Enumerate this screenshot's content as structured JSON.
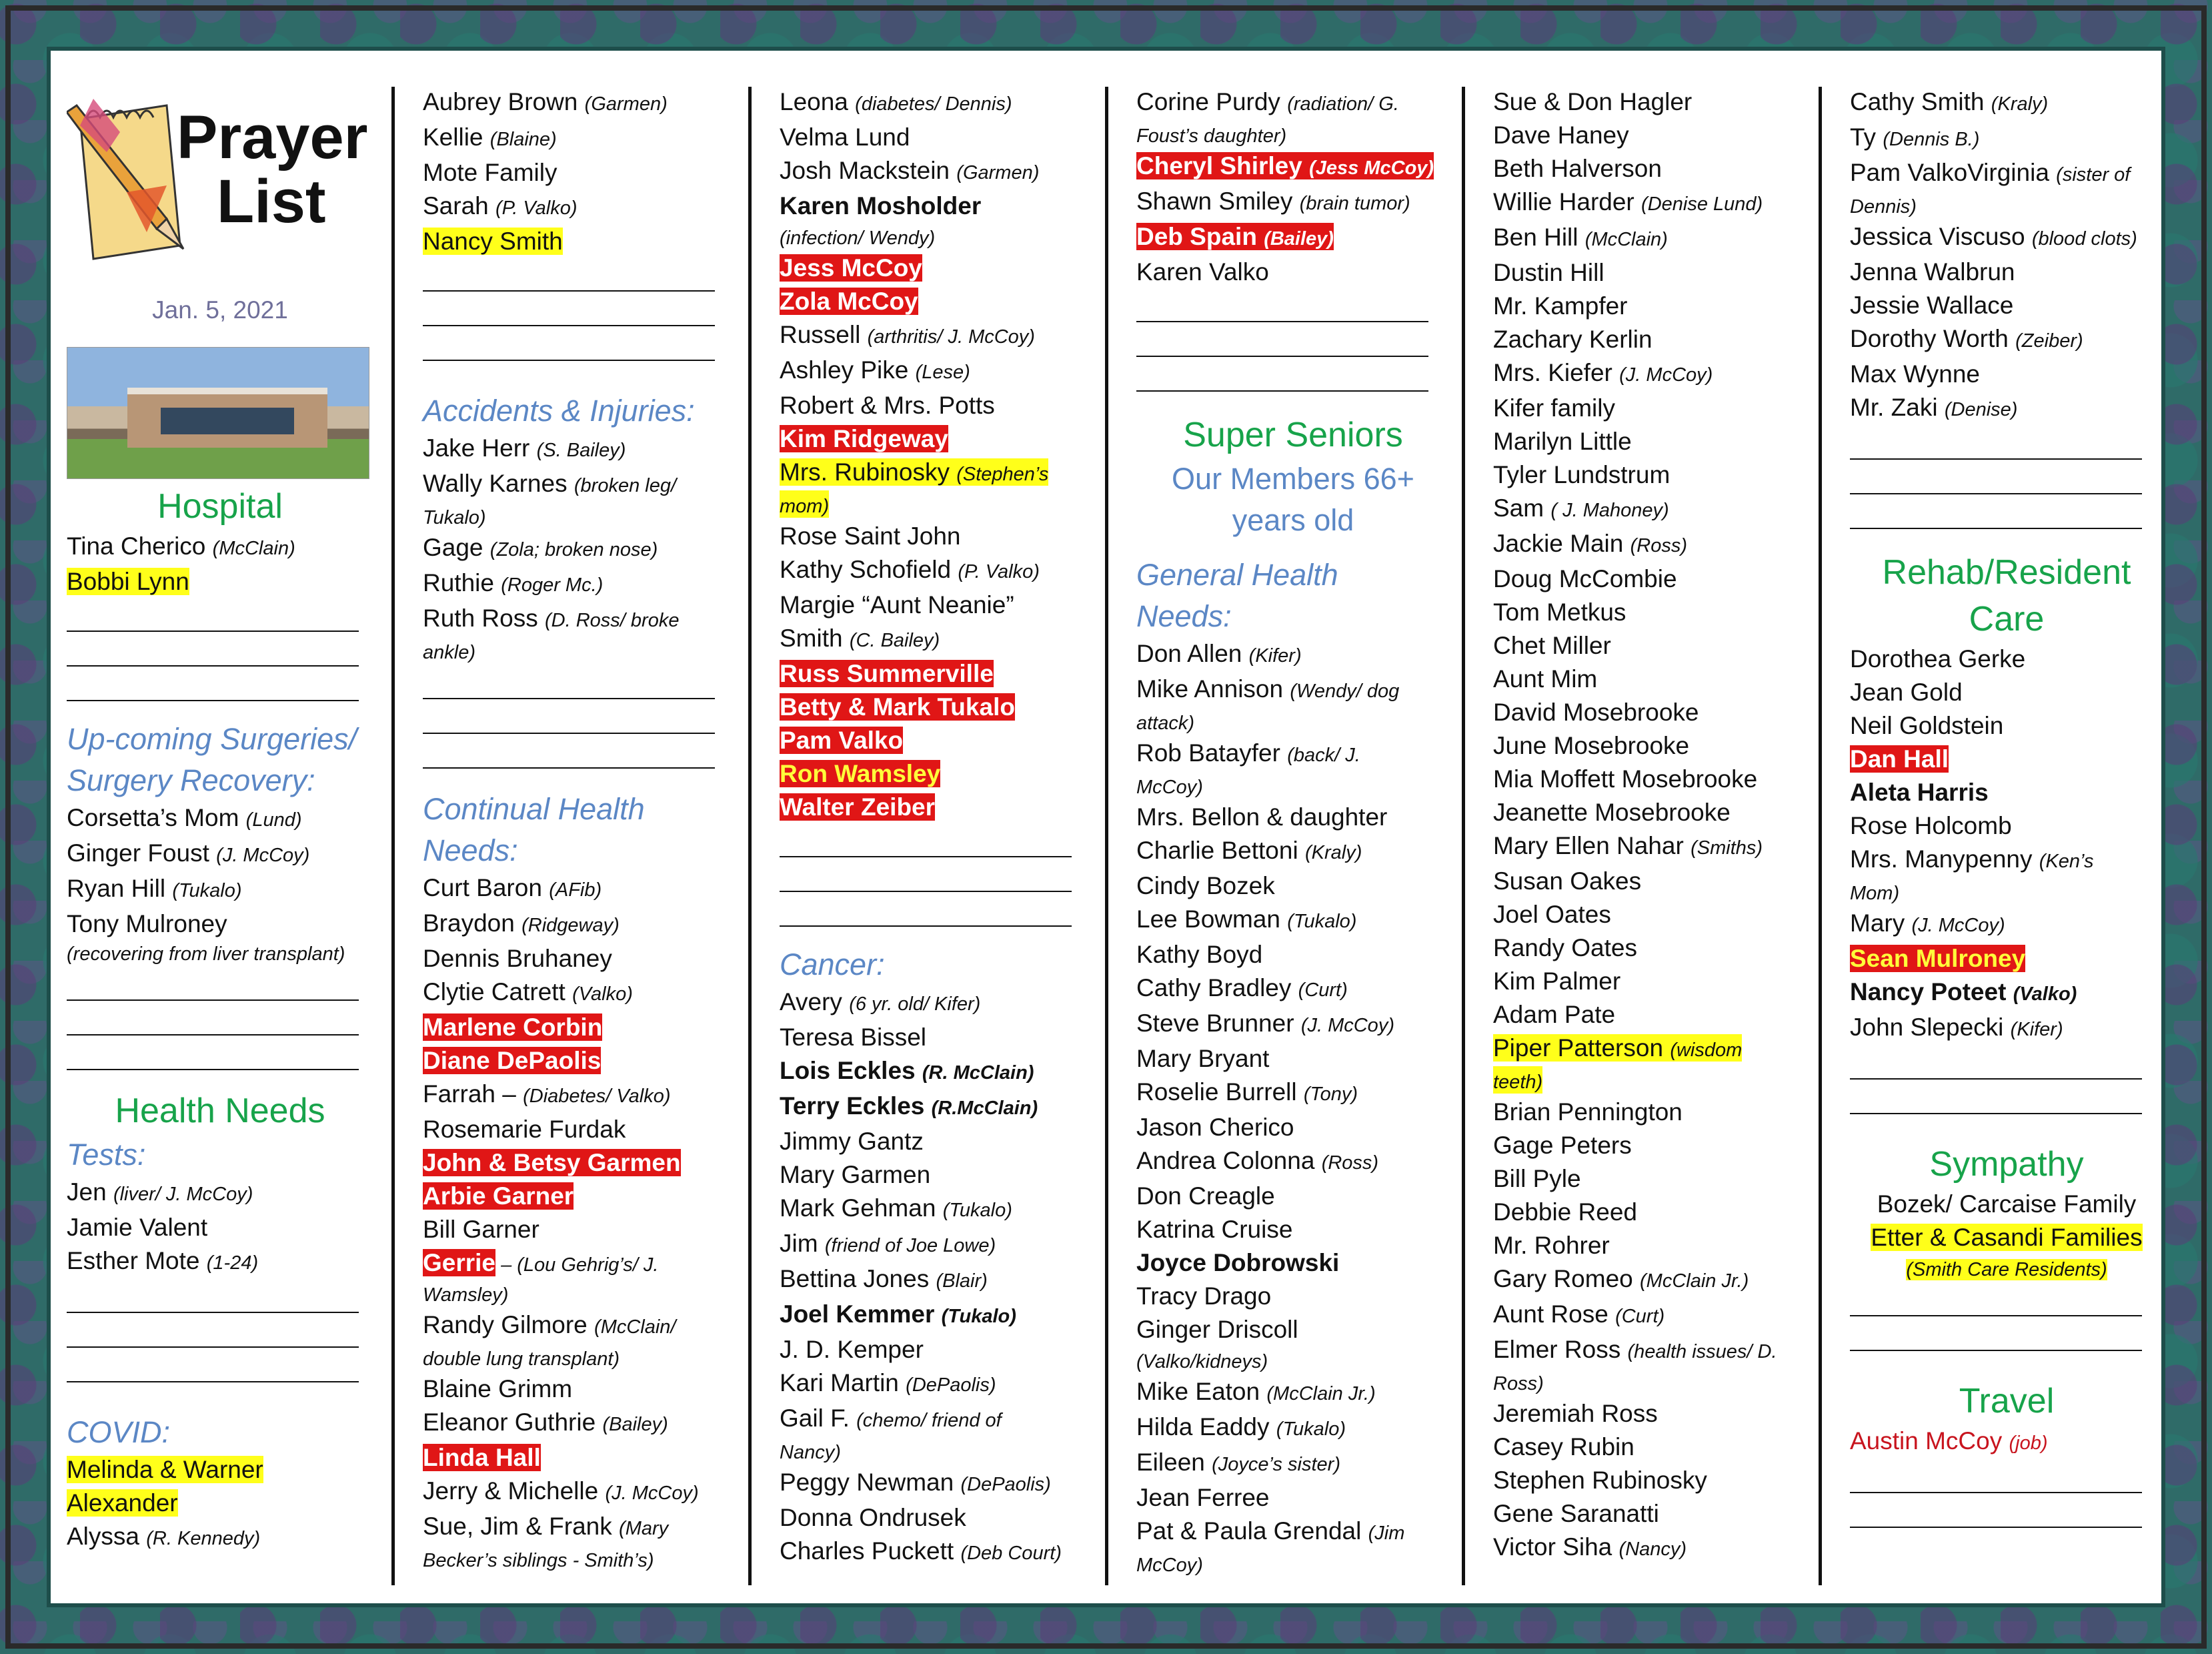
{
  "header": {
    "title_line1": "Prayer",
    "title_line2": "List",
    "date": "Jan. 5,  2021"
  },
  "col1": {
    "hospital_heading": "Hospital",
    "hospital": [
      {
        "name": "Tina Cherico ",
        "note": "(McClain)",
        "style": ""
      },
      {
        "name": "Bobbi Lynn",
        "note": "",
        "style": "hl-y"
      }
    ],
    "surgeries_heading_1": "Up-coming Surgeries/",
    "surgeries_heading_2": "Surgery Recovery:",
    "surgeries": [
      {
        "name": "Corsetta’s Mom ",
        "note": "(Lund)"
      },
      {
        "name": "Ginger Foust ",
        "note": "(J. McCoy)"
      },
      {
        "name": "Ryan Hill ",
        "note": "(Tukalo)"
      },
      {
        "name": "Tony Mulroney",
        "note": ""
      }
    ],
    "tony_note": "(recovering from liver transplant)",
    "health_heading": "Health Needs",
    "tests_heading": "Tests:",
    "tests": [
      {
        "name": "Jen ",
        "note": "(liver/ J. McCoy)"
      },
      {
        "name": "Jamie Valent",
        "note": ""
      },
      {
        "name": "Esther Mote ",
        "note": "(1-24)"
      }
    ],
    "covid_heading": "COVID:",
    "covid_1": "Melinda & Warner",
    "covid_2": "Alexander",
    "covid_3_name": "Alyssa ",
    "covid_3_note": "(R. Kennedy)"
  },
  "col2": {
    "top": [
      {
        "name": "Aubrey Brown ",
        "note": "(Garmen)",
        "style": ""
      },
      {
        "name": "Kellie ",
        "note": "(Blaine)",
        "style": ""
      },
      {
        "name": "Mote Family",
        "note": "",
        "style": ""
      },
      {
        "name": "Sarah ",
        "note": "(P. Valko)",
        "style": ""
      },
      {
        "name": "Nancy Smith",
        "note": "",
        "style": "hl-y"
      }
    ],
    "accidents_heading": "Accidents & Injuries:",
    "accidents": [
      {
        "name": "Jake Herr ",
        "note": "(S. Bailey)"
      },
      {
        "name": "Wally Karnes ",
        "note": "(broken leg/"
      },
      {
        "name": "",
        "note": "Tukalo)"
      },
      {
        "name": "Gage ",
        "note": "(Zola; broken nose)"
      },
      {
        "name": "Ruthie ",
        "note": "(Roger Mc.)"
      },
      {
        "name": "Ruth Ross ",
        "note": "(D. Ross/ broke"
      },
      {
        "name": "",
        "note": "ankle)"
      }
    ],
    "continual_heading_1": "Continual Health",
    "continual_heading_2": "Needs:",
    "continual": [
      {
        "name": "Curt Baron ",
        "note": "(AFib)",
        "style": ""
      },
      {
        "name": "Braydon ",
        "note": "(Ridgeway)",
        "style": ""
      },
      {
        "name": "Dennis Bruhaney",
        "note": "",
        "style": ""
      },
      {
        "name": "Clytie Catrett ",
        "note": "(Valko)",
        "style": ""
      },
      {
        "name": "Marlene Corbin",
        "note": "",
        "style": "hl-r"
      },
      {
        "name": "Diane DePaolis",
        "note": "",
        "style": "hl-r"
      },
      {
        "name": "Farrah – ",
        "note": "(Diabetes/ Valko)",
        "style": ""
      },
      {
        "name": "Rosemarie Furdak",
        "note": "",
        "style": ""
      },
      {
        "name": "John & Betsy Garmen",
        "note": "",
        "style": "hl-r"
      },
      {
        "name": "Arbie Garner",
        "note": "",
        "style": "hl-r"
      },
      {
        "name": "Bill Garner",
        "note": "",
        "style": ""
      }
    ],
    "gerrie_name": "Gerrie",
    "gerrie_note_1": " – (Lou Gehrig’s/ J.",
    "gerrie_note_2": "Wamsley)",
    "continual2": [
      {
        "name": "Randy Gilmore ",
        "note": "(McClain/"
      },
      {
        "name": "",
        "note": "double lung transplant)"
      },
      {
        "name": "Blaine Grimm",
        "note": ""
      },
      {
        "name": "Eleanor Guthrie ",
        "note": "(Bailey)"
      }
    ],
    "linda": "Linda Hall",
    "end": [
      {
        "name": "Jerry & Michelle ",
        "note": "(J. McCoy)"
      },
      {
        "name": "Sue, Jim & Frank ",
        "note": "(Mary"
      },
      {
        "name": "",
        "note": "Becker’s siblings - Smith’s)"
      }
    ]
  },
  "col3": {
    "top": [
      {
        "name": "Leona ",
        "note": "(diabetes/ Dennis)",
        "style": ""
      },
      {
        "name": "Velma Lund",
        "note": "",
        "style": ""
      },
      {
        "name": "Josh Mackstein ",
        "note": "(Garmen)",
        "style": ""
      },
      {
        "name": "Karen Mosholder",
        "note": "",
        "style": "b"
      },
      {
        "name": "",
        "note": "(infection/ Wendy)",
        "style": ""
      },
      {
        "name": "Jess McCoy",
        "note": "",
        "style": "hl-r"
      },
      {
        "name": "Zola McCoy",
        "note": "",
        "style": "hl-r"
      },
      {
        "name": "Russell ",
        "note": "(arthritis/ J. McCoy)",
        "style": ""
      },
      {
        "name": "Ashley Pike ",
        "note": "(Lese)",
        "style": ""
      },
      {
        "name": "Robert & Mrs. Potts",
        "note": "",
        "style": ""
      },
      {
        "name": "Kim Ridgeway",
        "note": "",
        "style": "hl-r"
      },
      {
        "name": "Mrs. Rubinosky ",
        "note": "(Stephen’s",
        "style": "hl-y"
      },
      {
        "name": "",
        "note": "mom)",
        "style": "hl-y"
      },
      {
        "name": "Rose Saint John",
        "note": "",
        "style": ""
      },
      {
        "name": "Kathy Schofield ",
        "note": "(P. Valko)",
        "style": ""
      },
      {
        "name": "Margie “Aunt Neanie”",
        "note": "",
        "style": ""
      },
      {
        "name": "Smith ",
        "note": "(C. Bailey)",
        "style": ""
      },
      {
        "name": "Russ Summerville",
        "note": "",
        "style": "hl-r"
      },
      {
        "name": "Betty  & Mark Tukalo",
        "note": "",
        "style": "hl-r"
      },
      {
        "name": "Pam Valko",
        "note": "",
        "style": "hl-r"
      },
      {
        "name": "Ron Wamsley",
        "note": "",
        "style": "hl-ry"
      },
      {
        "name": "Walter Zeiber",
        "note": "",
        "style": "hl-r"
      }
    ],
    "cancer_heading": "Cancer:",
    "cancer": [
      {
        "name": "Avery ",
        "note": "(6 yr. old/ Kifer)",
        "style": ""
      },
      {
        "name": "Teresa Bissel",
        "note": "",
        "style": ""
      },
      {
        "name": "Lois Eckles ",
        "note": "(R. McClain)",
        "style": "b"
      },
      {
        "name": "Terry Eckles ",
        "note": "(R.McClain)",
        "style": "b"
      },
      {
        "name": "Jimmy Gantz",
        "note": "",
        "style": ""
      },
      {
        "name": "Mary Garmen",
        "note": "",
        "style": ""
      },
      {
        "name": "Mark Gehman ",
        "note": "(Tukalo)",
        "style": ""
      },
      {
        "name": "Jim ",
        "note": "(friend of Joe Lowe)",
        "style": ""
      },
      {
        "name": "Bettina Jones ",
        "note": "(Blair)",
        "style": ""
      },
      {
        "name": "Joel Kemmer ",
        "note": "(Tukalo)",
        "style": "b"
      },
      {
        "name": "J. D. Kemper",
        "note": "",
        "style": ""
      },
      {
        "name": "Kari Martin ",
        "note": "(DePaolis)",
        "style": ""
      },
      {
        "name": "Gail F. ",
        "note": "(chemo/ friend of",
        "style": ""
      },
      {
        "name": "",
        "note": "Nancy)",
        "style": ""
      },
      {
        "name": "Peggy Newman ",
        "note": "(DePaolis)",
        "style": ""
      },
      {
        "name": "Donna Ondrusek",
        "note": "",
        "style": ""
      },
      {
        "name": "Charles Puckett ",
        "note": "(Deb Court)",
        "style": ""
      }
    ]
  },
  "col4": {
    "top": [
      {
        "name": "Corine Purdy ",
        "note": "(radiation/ G.",
        "style": ""
      },
      {
        "name": "",
        "note": "Foust’s daughter)",
        "style": ""
      },
      {
        "name": "Cheryl Shirley ",
        "note": "(Jess McCoy)",
        "style": "hl-r"
      },
      {
        "name": "Shawn Smiley ",
        "note": "(brain tumor)",
        "style": ""
      },
      {
        "name": "Deb Spain ",
        "note": "(Bailey)",
        "style": "hl-r"
      },
      {
        "name": "Karen Valko",
        "note": "",
        "style": ""
      }
    ],
    "seniors_heading": "Super Seniors",
    "seniors_sub_1": "Our Members 66+",
    "seniors_sub_2": "years old",
    "general_heading_1": "General Health",
    "general_heading_2": "Needs:",
    "general": [
      {
        "name": "Don Allen ",
        "note": "(Kifer)",
        "style": ""
      },
      {
        "name": "Mike Annison ",
        "note": "(Wendy/ dog",
        "style": ""
      },
      {
        "name": "",
        "note": "attack)",
        "style": ""
      },
      {
        "name": "Rob Batayfer ",
        "note": "(back/ J.",
        "style": ""
      },
      {
        "name": "",
        "note": "McCoy)",
        "style": ""
      },
      {
        "name": "Mrs. Bellon & daughter",
        "note": "",
        "style": ""
      },
      {
        "name": "Charlie Bettoni ",
        "note": "(Kraly)",
        "style": ""
      },
      {
        "name": "Cindy Bozek",
        "note": "",
        "style": ""
      },
      {
        "name": "Lee Bowman ",
        "note": "(Tukalo)",
        "style": ""
      },
      {
        "name": "Kathy Boyd",
        "note": "",
        "style": ""
      },
      {
        "name": "Cathy Bradley ",
        "note": "(Curt)",
        "style": ""
      },
      {
        "name": "Steve Brunner ",
        "note": "(J. McCoy)",
        "style": ""
      },
      {
        "name": "Mary Bryant",
        "note": "",
        "style": ""
      },
      {
        "name": "Roselie Burrell ",
        "note": "(Tony)",
        "style": ""
      },
      {
        "name": "Jason Cherico",
        "note": "",
        "style": ""
      },
      {
        "name": "Andrea Colonna ",
        "note": "(Ross)",
        "style": ""
      },
      {
        "name": "Don Creagle",
        "note": "",
        "style": ""
      },
      {
        "name": "Katrina Cruise",
        "note": "",
        "style": ""
      },
      {
        "name": "Joyce Dobrowski",
        "note": "",
        "style": "b"
      },
      {
        "name": "Tracy Drago",
        "note": "",
        "style": ""
      },
      {
        "name": "Ginger Driscoll",
        "note": "",
        "style": ""
      },
      {
        "name": "",
        "note": "(Valko/kidneys)",
        "style": ""
      },
      {
        "name": "Mike Eaton ",
        "note": "(McClain Jr.)",
        "style": ""
      },
      {
        "name": "Hilda Eaddy ",
        "note": "(Tukalo)",
        "style": ""
      },
      {
        "name": "Eileen ",
        "note": "(Joyce’s sister)",
        "style": ""
      },
      {
        "name": "Jean Ferree",
        "note": "",
        "style": ""
      },
      {
        "name": "Pat & Paula Grendal ",
        "note": "(Jim",
        "style": ""
      },
      {
        "name": "",
        "note": "McCoy)",
        "style": ""
      }
    ]
  },
  "col5": {
    "items": [
      {
        "name": "Sue & Don Hagler",
        "note": "",
        "style": ""
      },
      {
        "name": "Dave Haney",
        "note": "",
        "style": ""
      },
      {
        "name": "Beth Halverson",
        "note": "",
        "style": ""
      },
      {
        "name": "Willie Harder ",
        "note": "(Denise Lund)",
        "style": ""
      },
      {
        "name": "Ben Hill ",
        "note": "(McClain)",
        "style": ""
      },
      {
        "name": "Dustin Hill",
        "note": "",
        "style": ""
      },
      {
        "name": "Mr. Kampfer",
        "note": "",
        "style": ""
      },
      {
        "name": "Zachary Kerlin",
        "note": "",
        "style": ""
      },
      {
        "name": "Mrs. Kiefer ",
        "note": "(J. McCoy)",
        "style": ""
      },
      {
        "name": "Kifer family",
        "note": "",
        "style": ""
      },
      {
        "name": "Marilyn Little",
        "note": "",
        "style": ""
      },
      {
        "name": "Tyler Lundstrum",
        "note": "",
        "style": ""
      },
      {
        "name": "Sam ",
        "note": "( J. Mahoney)",
        "style": ""
      },
      {
        "name": "Jackie Main ",
        "note": "(Ross)",
        "style": ""
      },
      {
        "name": "Doug McCombie",
        "note": "",
        "style": ""
      },
      {
        "name": "Tom Metkus",
        "note": "",
        "style": ""
      },
      {
        "name": "Chet Miller",
        "note": "",
        "style": ""
      },
      {
        "name": "Aunt Mim",
        "note": "",
        "style": ""
      },
      {
        "name": "David Mosebrooke",
        "note": "",
        "style": ""
      },
      {
        "name": "June Mosebrooke",
        "note": "",
        "style": ""
      },
      {
        "name": "Mia Moffett Mosebrooke",
        "note": "",
        "style": ""
      },
      {
        "name": "Jeanette Mosebrooke",
        "note": "",
        "style": ""
      },
      {
        "name": "Mary Ellen Nahar ",
        "note": "(Smiths)",
        "style": ""
      },
      {
        "name": "Susan Oakes",
        "note": "",
        "style": ""
      },
      {
        "name": "Joel Oates",
        "note": "",
        "style": ""
      },
      {
        "name": "Randy Oates",
        "note": "",
        "style": ""
      },
      {
        "name": "Kim Palmer",
        "note": "",
        "style": ""
      },
      {
        "name": "Adam Pate",
        "note": "",
        "style": ""
      },
      {
        "name": "Piper Patterson ",
        "note": "(wisdom",
        "style": "hl-y"
      },
      {
        "name": "",
        "note": "teeth)",
        "style": "hl-y"
      },
      {
        "name": "Brian Pennington",
        "note": "",
        "style": ""
      },
      {
        "name": "Gage Peters",
        "note": "",
        "style": ""
      },
      {
        "name": "Bill Pyle",
        "note": "",
        "style": ""
      },
      {
        "name": "Debbie Reed",
        "note": "",
        "style": ""
      },
      {
        "name": "Mr. Rohrer",
        "note": "",
        "style": ""
      },
      {
        "name": "Gary Romeo ",
        "note": "(McClain Jr.)",
        "style": ""
      },
      {
        "name": "Aunt Rose ",
        "note": "(Curt)",
        "style": ""
      },
      {
        "name": "Elmer Ross ",
        "note": "(health issues/ D.",
        "style": ""
      },
      {
        "name": "",
        "note": "Ross)",
        "style": ""
      },
      {
        "name": "Jeremiah Ross",
        "note": "",
        "style": ""
      },
      {
        "name": "Casey Rubin",
        "note": "",
        "style": ""
      },
      {
        "name": "Stephen Rubinosky",
        "note": "",
        "style": ""
      },
      {
        "name": "Gene Saranatti",
        "note": "",
        "style": ""
      },
      {
        "name": "Victor Siha ",
        "note": "(Nancy)",
        "style": ""
      }
    ]
  },
  "col6": {
    "top": [
      {
        "name": "Cathy Smith ",
        "note": "(Kraly)",
        "style": ""
      },
      {
        "name": "Ty ",
        "note": "(Dennis B.)",
        "style": ""
      },
      {
        "name": "Pam ValkoVirginia ",
        "note": "(sister of",
        "style": ""
      },
      {
        "name": "",
        "note": "Dennis)",
        "style": ""
      },
      {
        "name": "Jessica Viscuso ",
        "note": "(blood clots)",
        "style": ""
      },
      {
        "name": "Jenna Walbrun",
        "note": "",
        "style": ""
      },
      {
        "name": "Jessie Wallace",
        "note": "",
        "style": ""
      },
      {
        "name": "Dorothy Worth ",
        "note": "(Zeiber)",
        "style": ""
      },
      {
        "name": "Max Wynne",
        "note": "",
        "style": ""
      },
      {
        "name": "Mr. Zaki ",
        "note": "(Denise)",
        "style": ""
      }
    ],
    "rehab_heading_1": "Rehab/Resident",
    "rehab_heading_2": "Care",
    "rehab": [
      {
        "name": "Dorothea Gerke",
        "note": "",
        "style": ""
      },
      {
        "name": "Jean Gold",
        "note": "",
        "style": ""
      },
      {
        "name": "Neil Goldstein",
        "note": "",
        "style": ""
      },
      {
        "name": "Dan Hall",
        "note": "",
        "style": "hl-r"
      },
      {
        "name": "Aleta Harris",
        "note": "",
        "style": "b"
      },
      {
        "name": "Rose Holcomb",
        "note": "",
        "style": ""
      },
      {
        "name": "Mrs. Manypenny ",
        "note": "(Ken’s",
        "style": ""
      },
      {
        "name": "",
        "note": "Mom)",
        "style": ""
      },
      {
        "name": "Mary ",
        "note": "(J. McCoy)",
        "style": ""
      },
      {
        "name": "Sean Mulroney",
        "note": "",
        "style": "hl-ry"
      },
      {
        "name": "Nancy Poteet ",
        "note": "(Valko)",
        "style": "b"
      },
      {
        "name": "John Slepecki ",
        "note": "(Kifer)",
        "style": ""
      }
    ],
    "sympathy_heading": "Sympathy",
    "sympathy_1": "Bozek/ Carcaise Family",
    "sympathy_2": "Etter & Casandi Families",
    "sympathy_3": "(Smith Care Residents)",
    "travel_heading": "Travel",
    "travel_name": "Austin McCoy ",
    "travel_note": "(job)"
  }
}
